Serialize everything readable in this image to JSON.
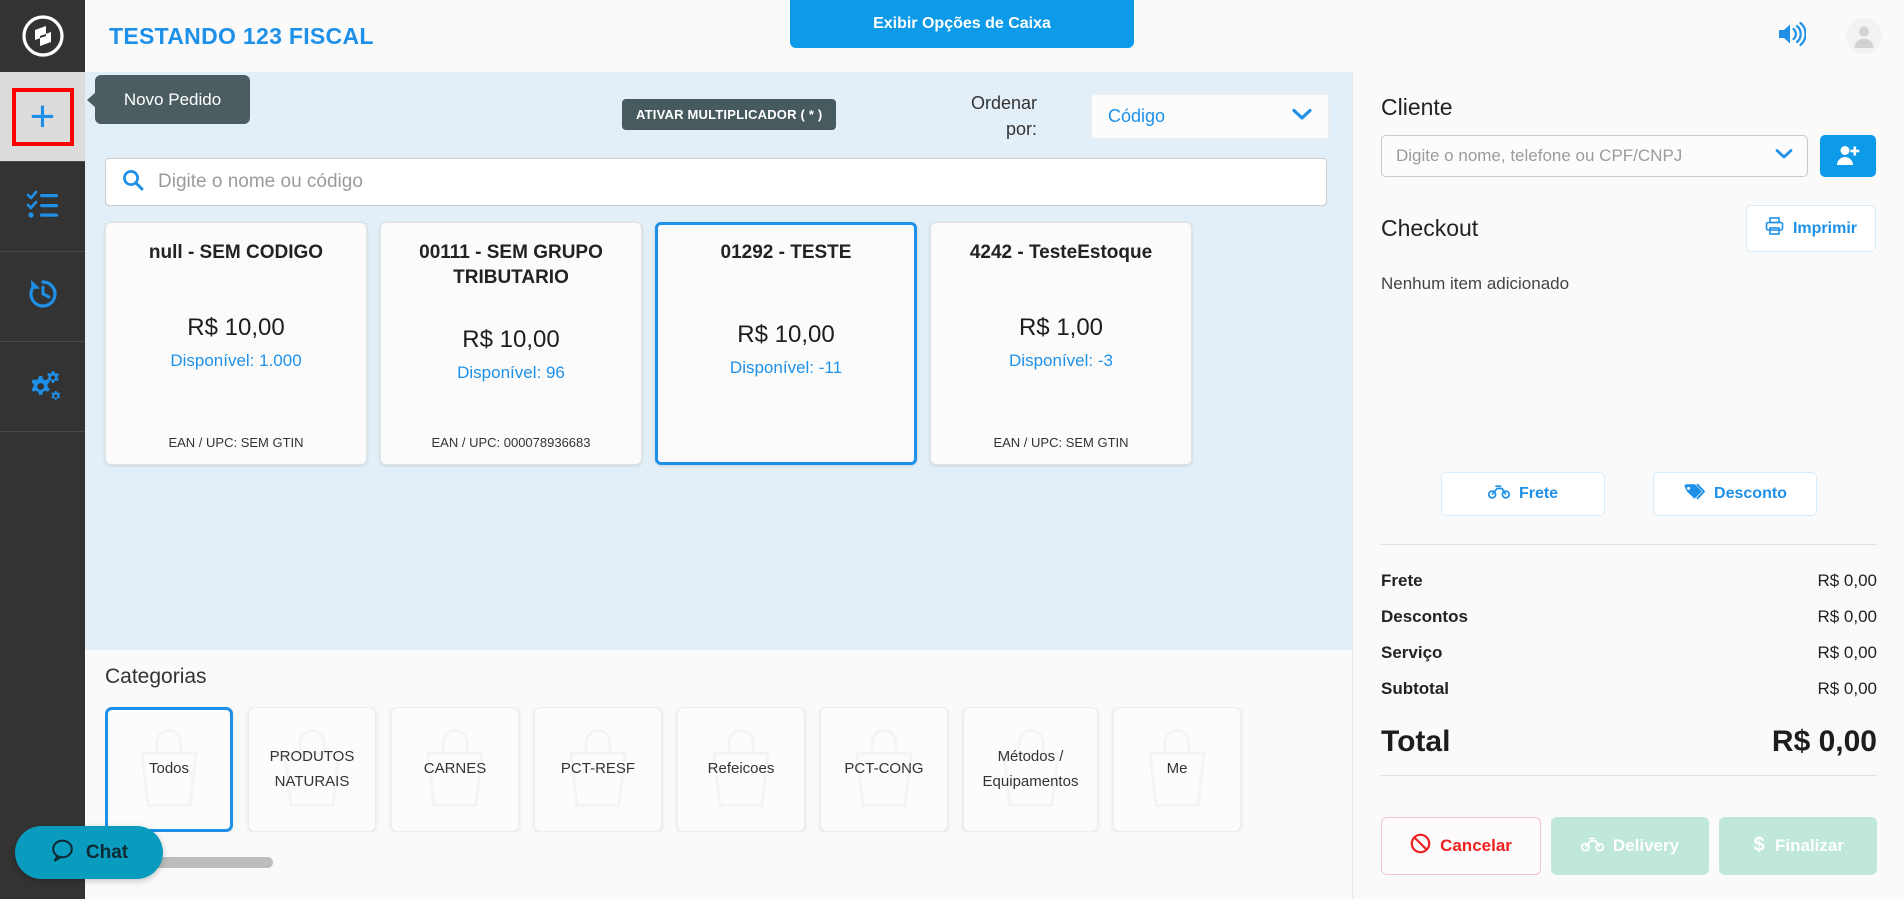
{
  "sidebar": {
    "logo_icon": "brand-logo-icon",
    "items": [
      {
        "id": "novo-pedido",
        "icon": "plus-icon",
        "active": true
      },
      {
        "id": "pedidos",
        "icon": "checklist-icon",
        "active": false
      },
      {
        "id": "historico",
        "icon": "history-clock-icon",
        "active": false
      },
      {
        "id": "configuracoes",
        "icon": "gears-icon",
        "active": false
      }
    ]
  },
  "tooltip": {
    "text": "Novo Pedido"
  },
  "header": {
    "store_title": "TESTANDO 123 FISCAL",
    "caixa_button": "Exibir Opções de Caixa",
    "sound_icon": "speaker-icon",
    "avatar_icon": "user-avatar-icon",
    "accent_color": "#0d9ae8",
    "title_color": "#1e90e8"
  },
  "products": {
    "multiplier_button": "ATIVAR MULTIPLICADOR ( * )",
    "order_label": "Ordenar por:",
    "order_value": "Código",
    "search_placeholder": "Digite o nome ou código",
    "search_value": "",
    "search_icon": "search-icon",
    "items": [
      {
        "name": "null - SEM CODIGO",
        "price": "R$ 10,00",
        "available": "Disponível: 1.000",
        "ean": "EAN / UPC: SEM GTIN",
        "selected": false
      },
      {
        "name": "00111 - SEM GRUPO TRIBUTARIO",
        "price": "R$ 10,00",
        "available": "Disponível: 96",
        "ean": "EAN / UPC: 000078936683",
        "selected": false
      },
      {
        "name": "01292 - TESTE",
        "price": "R$ 10,00",
        "available": "Disponível: -11",
        "ean": "",
        "selected": true
      },
      {
        "name": "4242 - TesteEstoque",
        "price": "R$ 1,00",
        "available": "Disponível: -3",
        "ean": "EAN / UPC: SEM GTIN",
        "selected": false
      }
    ]
  },
  "categories": {
    "title": "Categorias",
    "items": [
      {
        "label": "Todos",
        "selected": true
      },
      {
        "label": "PRODUTOS NATURAIS",
        "selected": false
      },
      {
        "label": "CARNES",
        "selected": false
      },
      {
        "label": "PCT-RESF",
        "selected": false
      },
      {
        "label": "Refeicoes",
        "selected": false
      },
      {
        "label": "PCT-CONG",
        "selected": false
      },
      {
        "label": "Métodos / Equipamentos",
        "selected": false
      },
      {
        "label": "Me",
        "selected": false
      }
    ]
  },
  "checkout": {
    "client_heading": "Cliente",
    "client_placeholder": "Digite o nome, telefone ou CPF/CNPJ",
    "client_value": "",
    "add_client_icon": "add-user-icon",
    "checkout_heading": "Checkout",
    "print_button": "Imprimir",
    "print_icon": "printer-icon",
    "empty_message": "Nenhum item adicionado",
    "frete_button": "Frete",
    "frete_icon": "motorcycle-icon",
    "desconto_button": "Desconto",
    "desconto_icon": "tag-icon",
    "totals": [
      {
        "label": "Frete",
        "value": "R$ 0,00"
      },
      {
        "label": "Descontos",
        "value": "R$ 0,00"
      },
      {
        "label": "Serviço",
        "value": "R$ 0,00"
      },
      {
        "label": "Subtotal",
        "value": "R$ 0,00"
      }
    ],
    "total_label": "Total",
    "total_value": "R$ 0,00",
    "actions": {
      "cancel": "Cancelar",
      "cancel_icon": "no-entry-icon",
      "delivery": "Delivery",
      "delivery_icon": "motorcycle-icon",
      "finalize": "Finalizar",
      "finalize_icon": "dollar-icon"
    }
  },
  "chat": {
    "label": "Chat",
    "icon": "chat-bubble-icon"
  }
}
